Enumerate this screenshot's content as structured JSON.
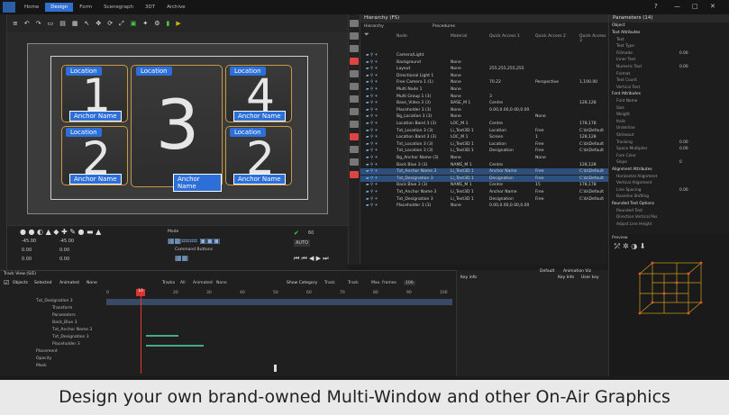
{
  "titlebar": {
    "tabs": [
      "Home",
      "Design",
      "Form",
      "Scenegraph",
      "3DT",
      "Archive"
    ],
    "active_tab": "Design",
    "window_controls": [
      "?",
      "—",
      "□",
      "✕"
    ]
  },
  "viewport": {
    "boxes": [
      {
        "location": "Location",
        "number": "1",
        "anchor": "Anchor Name"
      },
      {
        "location": "Location",
        "number": "3",
        "anchor": "Anchor Name"
      },
      {
        "location": "Location",
        "number": "4",
        "anchor": "Anchor Name"
      },
      {
        "location": "Location",
        "number": "2",
        "anchor": "Anchor Name"
      },
      {
        "location": "Location",
        "number": "2",
        "anchor": "Anchor Name"
      }
    ],
    "fields": [
      "-45.00",
      "-45.00",
      "0.00",
      "0.00",
      "0.00",
      "0.00"
    ],
    "mode_label": "Mode",
    "command_buttons_label": "Command Buttons",
    "auto_label": "AUTO",
    "zoom_value": "60"
  },
  "hierarchy": {
    "title": "Hierarchy (FS)",
    "subtabs": [
      "Hierarchy",
      "Procedures"
    ],
    "columns": [
      "Node",
      "Material",
      "Quick Access 1",
      "Quick Access 2",
      "Quick Access 3"
    ],
    "rows": [
      {
        "node": "Camera/Light",
        "material": "",
        "qa1": "",
        "qa2": "",
        "qa3": "",
        "selected": false
      },
      {
        "node": "Background",
        "material": "None",
        "qa1": "",
        "qa2": "",
        "qa3": "",
        "selected": false
      },
      {
        "node": "Layout",
        "material": "None",
        "qa1": "255,255,255,255",
        "qa2": "",
        "qa3": "",
        "selected": false
      },
      {
        "node": "Directional Light 1",
        "material": "None",
        "qa1": "",
        "qa2": "",
        "qa3": "",
        "selected": false
      },
      {
        "node": "Free Camera 1 (1)",
        "material": "None",
        "qa1": "70.22",
        "qa2": "Perspective",
        "qa3": "1,100.00",
        "selected": false
      },
      {
        "node": "Multi Node 1",
        "material": "None",
        "qa1": "",
        "qa2": "",
        "qa3": "",
        "selected": false
      },
      {
        "node": "Multi Group 1 (3)",
        "material": "None",
        "qa1": "3",
        "qa2": "",
        "qa3": "",
        "selected": false
      },
      {
        "node": "Base_Video 3 (3)",
        "material": "BASE_M 1",
        "qa1": "Centre",
        "qa2": "",
        "qa3": "128,128",
        "selected": false
      },
      {
        "node": "Placeholder 3 (3)",
        "material": "None",
        "qa1": "0.00,0.00,0.00,0.00",
        "qa2": "",
        "qa3": "",
        "selected": false
      },
      {
        "node": "Bg_Location 3 (3)",
        "material": "None",
        "qa1": "",
        "qa2": "None",
        "qa3": "",
        "selected": false
      },
      {
        "node": "Location Band 3 (3)",
        "material": "LOC_M 1",
        "qa1": "Centre",
        "qa2": "",
        "qa3": "178,178",
        "selected": false
      },
      {
        "node": "Txt_Location 3 (3)",
        "material": "Li_Text3D 1",
        "qa1": "Location",
        "qa2": "Free",
        "qa3": "C:\\b\\Default",
        "selected": false
      },
      {
        "node": "Location Band 3 (3)",
        "material": "LOC_M 1",
        "qa1": "Screen",
        "qa2": "1",
        "qa3": "128,128",
        "selected": false
      },
      {
        "node": "Txt_Location 3 (3)",
        "material": "Li_Text3D 1",
        "qa1": "Location",
        "qa2": "Free",
        "qa3": "C:\\b\\Default",
        "selected": false
      },
      {
        "node": "Txt_Location 3 (3)",
        "material": "Li_Text3D 1",
        "qa1": "Designation",
        "qa2": "Free",
        "qa3": "C:\\b\\Default",
        "selected": false
      },
      {
        "node": "Bg_Anchor Name (3)",
        "material": "None",
        "qa1": "",
        "qa2": "None",
        "qa3": "",
        "selected": false
      },
      {
        "node": "Back Blue 3 (3)",
        "material": "NAME_M 1",
        "qa1": "Centre",
        "qa2": "",
        "qa3": "128,128",
        "selected": false
      },
      {
        "node": "Txt_Anchor Name 3",
        "material": "Li_Text3D 1",
        "qa1": "Anchor Name",
        "qa2": "Free",
        "qa3": "C:\\b\\Default",
        "selected": true
      },
      {
        "node": "Txt_Designation 3",
        "material": "Li_Text3D 1",
        "qa1": "Designation",
        "qa2": "Free",
        "qa3": "C:\\b\\Default",
        "selected": true
      },
      {
        "node": "Back Blue 3 (3)",
        "material": "NAME_M 1",
        "qa1": "Centre",
        "qa2": "15",
        "qa3": "178,178",
        "selected": false
      },
      {
        "node": "Txt_Anchor Name 3",
        "material": "Li_Text3D 1",
        "qa1": "Anchor Name",
        "qa2": "Free",
        "qa3": "C:\\b\\Default",
        "selected": false
      },
      {
        "node": "Txt_Designation 3",
        "material": "Li_Text3D 1",
        "qa1": "Designation",
        "qa2": "Free",
        "qa3": "C:\\b\\Default",
        "selected": false
      },
      {
        "node": "Placeholder 3 (3)",
        "material": "None",
        "qa1": "0.00,0.00,0.00,0.00",
        "qa2": "",
        "qa3": "",
        "selected": false
      }
    ]
  },
  "parameters": {
    "title": "Parameters (14)",
    "object_label": "Object",
    "rows": [
      {
        "label": "Text Attributes",
        "value": "",
        "header": true
      },
      {
        "label": "Text",
        "value": "",
        "header": false
      },
      {
        "label": "Text Type",
        "value": "",
        "header": false
      },
      {
        "label": "Fillmode",
        "value": "0.00",
        "header": false
      },
      {
        "label": "Inner Text",
        "value": "",
        "header": false
      },
      {
        "label": "Numeric Text",
        "value": "0.00",
        "header": false
      },
      {
        "label": "Format",
        "value": "",
        "header": false
      },
      {
        "label": "Text Count",
        "value": "",
        "header": false
      },
      {
        "label": "Vertical Text",
        "value": "",
        "header": false
      },
      {
        "label": "Font Attributes",
        "value": "",
        "header": true
      },
      {
        "label": "Font Name",
        "value": "",
        "header": false
      },
      {
        "label": "Size",
        "value": "",
        "header": false
      },
      {
        "label": "Weight",
        "value": "",
        "header": false
      },
      {
        "label": "Italic",
        "value": "",
        "header": false
      },
      {
        "label": "Underline",
        "value": "",
        "header": false
      },
      {
        "label": "Strikeout",
        "value": "",
        "header": false
      },
      {
        "label": "Tracking",
        "value": "0.00",
        "header": false
      },
      {
        "label": "Space Multiplier",
        "value": "0.00",
        "header": false
      },
      {
        "label": "Fore Color",
        "value": "",
        "header": false
      },
      {
        "label": "Slope",
        "value": "0",
        "header": false
      },
      {
        "label": "Alignment Attributes",
        "value": "",
        "header": true
      },
      {
        "label": "Horizontal Alignment",
        "value": "",
        "header": false
      },
      {
        "label": "Vertical Alignment",
        "value": "",
        "header": false
      },
      {
        "label": "Line Spacing",
        "value": "0.00",
        "header": false
      },
      {
        "label": "Baseline Shifting",
        "value": "",
        "header": false
      },
      {
        "label": "Rounded Text Options",
        "value": "",
        "header": true
      },
      {
        "label": "Rounded Text",
        "value": "",
        "header": false
      },
      {
        "label": "Direction Vertical Pos",
        "value": "",
        "header": false
      },
      {
        "label": "Adjust Line Height",
        "value": "",
        "header": false
      }
    ]
  },
  "preview": {
    "title": "Preview"
  },
  "timeline": {
    "title": "Track View (S/E)",
    "options": [
      "Objects",
      "Selected",
      "Animated",
      "None"
    ],
    "tracks_label": "Tracks",
    "track_buttons": [
      "All",
      "Animated",
      "None"
    ],
    "show_category": "Show Category",
    "extra_options": [
      "Track",
      "Track",
      "Max. frames"
    ],
    "max_frames": "100",
    "ticks": [
      "0",
      "10",
      "20",
      "30",
      "40",
      "50",
      "60",
      "70",
      "80",
      "90",
      "100"
    ],
    "current_frame": "10",
    "tree": [
      "Txt_Designation 3",
      "Transform",
      "Parameters",
      "Back_Blue 3",
      "Txt_Anchor Name 3",
      "Txt_Designation 3",
      "Placeholder 3",
      "Placement",
      "Opacity",
      "Mask"
    ],
    "default_label": "Default",
    "animation_label": "Animation Viz",
    "key_info": "Key info",
    "key_info_sub": "Key Info",
    "user_key": "User key"
  },
  "caption": "Design your own brand-owned Multi-Window and other On-Air Graphics"
}
